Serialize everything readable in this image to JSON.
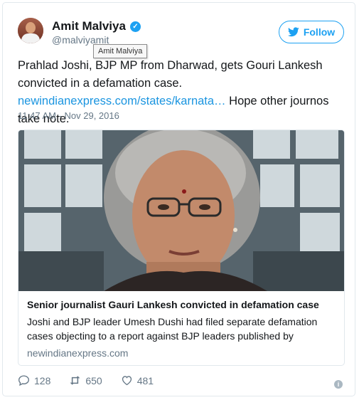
{
  "author": {
    "name": "Amit Malviya",
    "handle": "@malviyamit",
    "tooltip": "Amit Malviya",
    "verified_icon": "verified-badge-icon"
  },
  "follow_button": {
    "label": "Follow"
  },
  "tweet": {
    "text_part1": "Prahlad Joshi, BJP MP from Dharwad, gets Gouri Lankesh convicted in a defamation case. ",
    "link_text": "newindianexpress.com/states/karnata…",
    "text_part2": " Hope other journos take note.",
    "timestamp": "11:47 AM - Nov 29, 2016"
  },
  "card": {
    "title": "Senior journalist Gauri Lankesh convicted in defamation case",
    "description": "Joshi and BJP leader Umesh Dushi had filed separate defamation cases objecting to a report against BJP leaders published by",
    "domain": "newindianexpress.com"
  },
  "actions": {
    "replies": "128",
    "retweets": "650",
    "likes": "481"
  },
  "colors": {
    "accent": "#1da1f2",
    "link": "#1b95e0",
    "secondary_text": "#657786"
  }
}
